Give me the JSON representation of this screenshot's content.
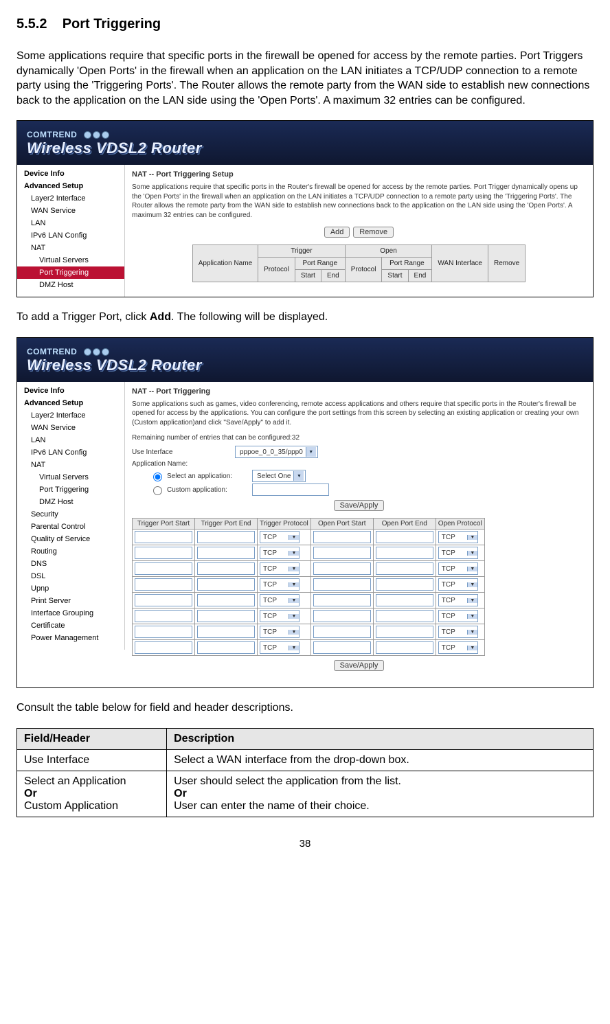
{
  "section": {
    "number": "5.5.2",
    "title": "Port Triggering"
  },
  "paragraphs": {
    "intro": "Some applications require that specific ports in the firewall be opened for access by the remote parties.   Port Triggers dynamically 'Open Ports' in the firewall when an application on the LAN initiates a TCP/UDP connection to a remote party using the 'Triggering Ports'.   The Router allows the remote party from the WAN side to establish new connections back to the application on the LAN side using the 'Open Ports'.   A maximum 32 entries can be configured.",
    "add_instruction_pre": "To add a Trigger Port, click ",
    "add_instruction_bold": "Add",
    "add_instruction_post": ". The following will be displayed.",
    "consult": "Consult the table below for field and header descriptions."
  },
  "banner": {
    "brand": "COMTREND",
    "product": "Wireless VDSL2 Router"
  },
  "panel1": {
    "sidebar": [
      {
        "label": "Device Info",
        "bold": true
      },
      {
        "label": "Advanced Setup",
        "bold": true
      },
      {
        "label": "Layer2 Interface",
        "indent": 1
      },
      {
        "label": "WAN Service",
        "indent": 1
      },
      {
        "label": "LAN",
        "indent": 1
      },
      {
        "label": "IPv6 LAN Config",
        "indent": 1
      },
      {
        "label": "NAT",
        "indent": 1
      },
      {
        "label": "Virtual Servers",
        "indent": 2
      },
      {
        "label": "Port Triggering",
        "indent": 2,
        "selected": true
      },
      {
        "label": "DMZ Host",
        "indent": 2
      }
    ],
    "content_title": "NAT -- Port Triggering Setup",
    "content_intro": "Some applications require that specific ports in the Router's firewall be opened for access by the remote parties. Port Trigger dynamically opens up the 'Open Ports' in the firewall when an application on the LAN initiates a TCP/UDP connection to a remote party using the 'Triggering Ports'. The Router allows the remote party from the WAN side to establish new connections back to the application on the LAN side using the 'Open Ports'. A maximum 32 entries can be configured.",
    "buttons": {
      "add": "Add",
      "remove": "Remove"
    },
    "table_headers": {
      "app_name": "Application Name",
      "trigger": "Trigger",
      "open": "Open",
      "protocol": "Protocol",
      "port_range": "Port Range",
      "start": "Start",
      "end": "End",
      "wan_if": "WAN Interface",
      "remove": "Remove"
    }
  },
  "panel2": {
    "sidebar": [
      {
        "label": "Device Info",
        "bold": true
      },
      {
        "label": "Advanced Setup",
        "bold": true
      },
      {
        "label": "Layer2 Interface",
        "indent": 1
      },
      {
        "label": "WAN Service",
        "indent": 1
      },
      {
        "label": "LAN",
        "indent": 1
      },
      {
        "label": "IPv6 LAN Config",
        "indent": 1
      },
      {
        "label": "NAT",
        "indent": 1
      },
      {
        "label": "Virtual Servers",
        "indent": 2
      },
      {
        "label": "Port Triggering",
        "indent": 2
      },
      {
        "label": "DMZ Host",
        "indent": 2
      },
      {
        "label": "Security",
        "indent": 1
      },
      {
        "label": "Parental Control",
        "indent": 1
      },
      {
        "label": "Quality of Service",
        "indent": 1
      },
      {
        "label": "Routing",
        "indent": 1
      },
      {
        "label": "DNS",
        "indent": 1
      },
      {
        "label": "DSL",
        "indent": 1
      },
      {
        "label": "Upnp",
        "indent": 1
      },
      {
        "label": "Print Server",
        "indent": 1
      },
      {
        "label": "Interface Grouping",
        "indent": 1
      },
      {
        "label": "Certificate",
        "indent": 1
      },
      {
        "label": "Power Management",
        "indent": 1
      }
    ],
    "content_title": "NAT -- Port Triggering",
    "content_intro": "Some applications such as games, video conferencing, remote access applications and others require that specific ports in the Router's firewall be opened for access by the applications. You can configure the port settings from this screen by selecting an existing application or creating your own (Custom application)and click \"Save/Apply\" to add it.",
    "remaining_label": "Remaining number of entries that can be configured:32",
    "form": {
      "use_if_label": "Use Interface",
      "use_if_value": "pppoe_0_0_35/ppp0",
      "app_name_label": "Application Name:",
      "select_app_label": "Select an application:",
      "select_app_value": "Select One",
      "custom_app_label": "Custom application:",
      "save_apply": "Save/Apply"
    },
    "grid_headers": {
      "tps": "Trigger Port Start",
      "tpe": "Trigger Port End",
      "tp": "Trigger Protocol",
      "ops": "Open Port Start",
      "ope": "Open Port End",
      "op": "Open Protocol"
    },
    "grid_proto": "TCP",
    "grid_rows": 8
  },
  "desc_table": {
    "header_field": "Field/Header",
    "header_desc": "Description",
    "rows": [
      {
        "field": "Use Interface",
        "desc": "Select a WAN interface from the drop-down box."
      },
      {
        "field_lines": [
          "Select an Application",
          "Or",
          "Custom Application"
        ],
        "desc_lines": [
          "User should select the application from the list.",
          "Or",
          "User can enter the name of their choice."
        ]
      }
    ]
  },
  "page_number": "38"
}
